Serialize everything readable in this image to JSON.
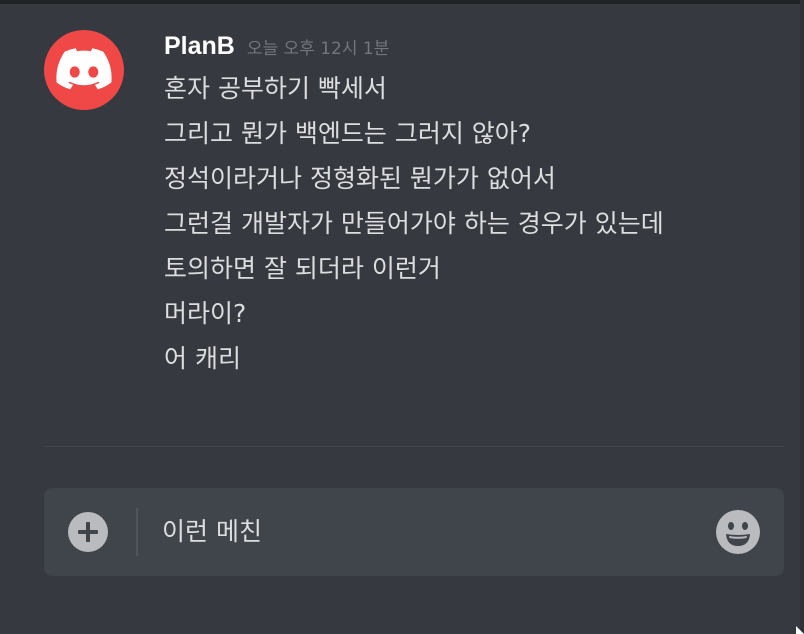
{
  "message": {
    "username": "PlanB",
    "timestamp": "오늘 오후 12시 1분",
    "avatar_icon": "discord-logo-icon",
    "avatar_color": "#f04747",
    "lines": [
      "혼자 공부하기 빡세서",
      "그리고 뭔가 백엔드는 그러지 않아?",
      "정석이라거나 정형화된 뭔가가 없어서",
      "그런걸 개발자가 만들어가야 하는 경우가 있는데",
      "토의하면 잘 되더라 이런거",
      "머라이?",
      "어 캐리"
    ]
  },
  "composer": {
    "value": "이런 메친",
    "attach_icon": "plus-circle-icon",
    "emoji_icon": "smiley-emoji-icon"
  },
  "colors": {
    "background": "#36393f",
    "composer_bg": "#40444b",
    "text": "#dcddde",
    "username": "#ffffff",
    "timestamp": "#72767d"
  }
}
